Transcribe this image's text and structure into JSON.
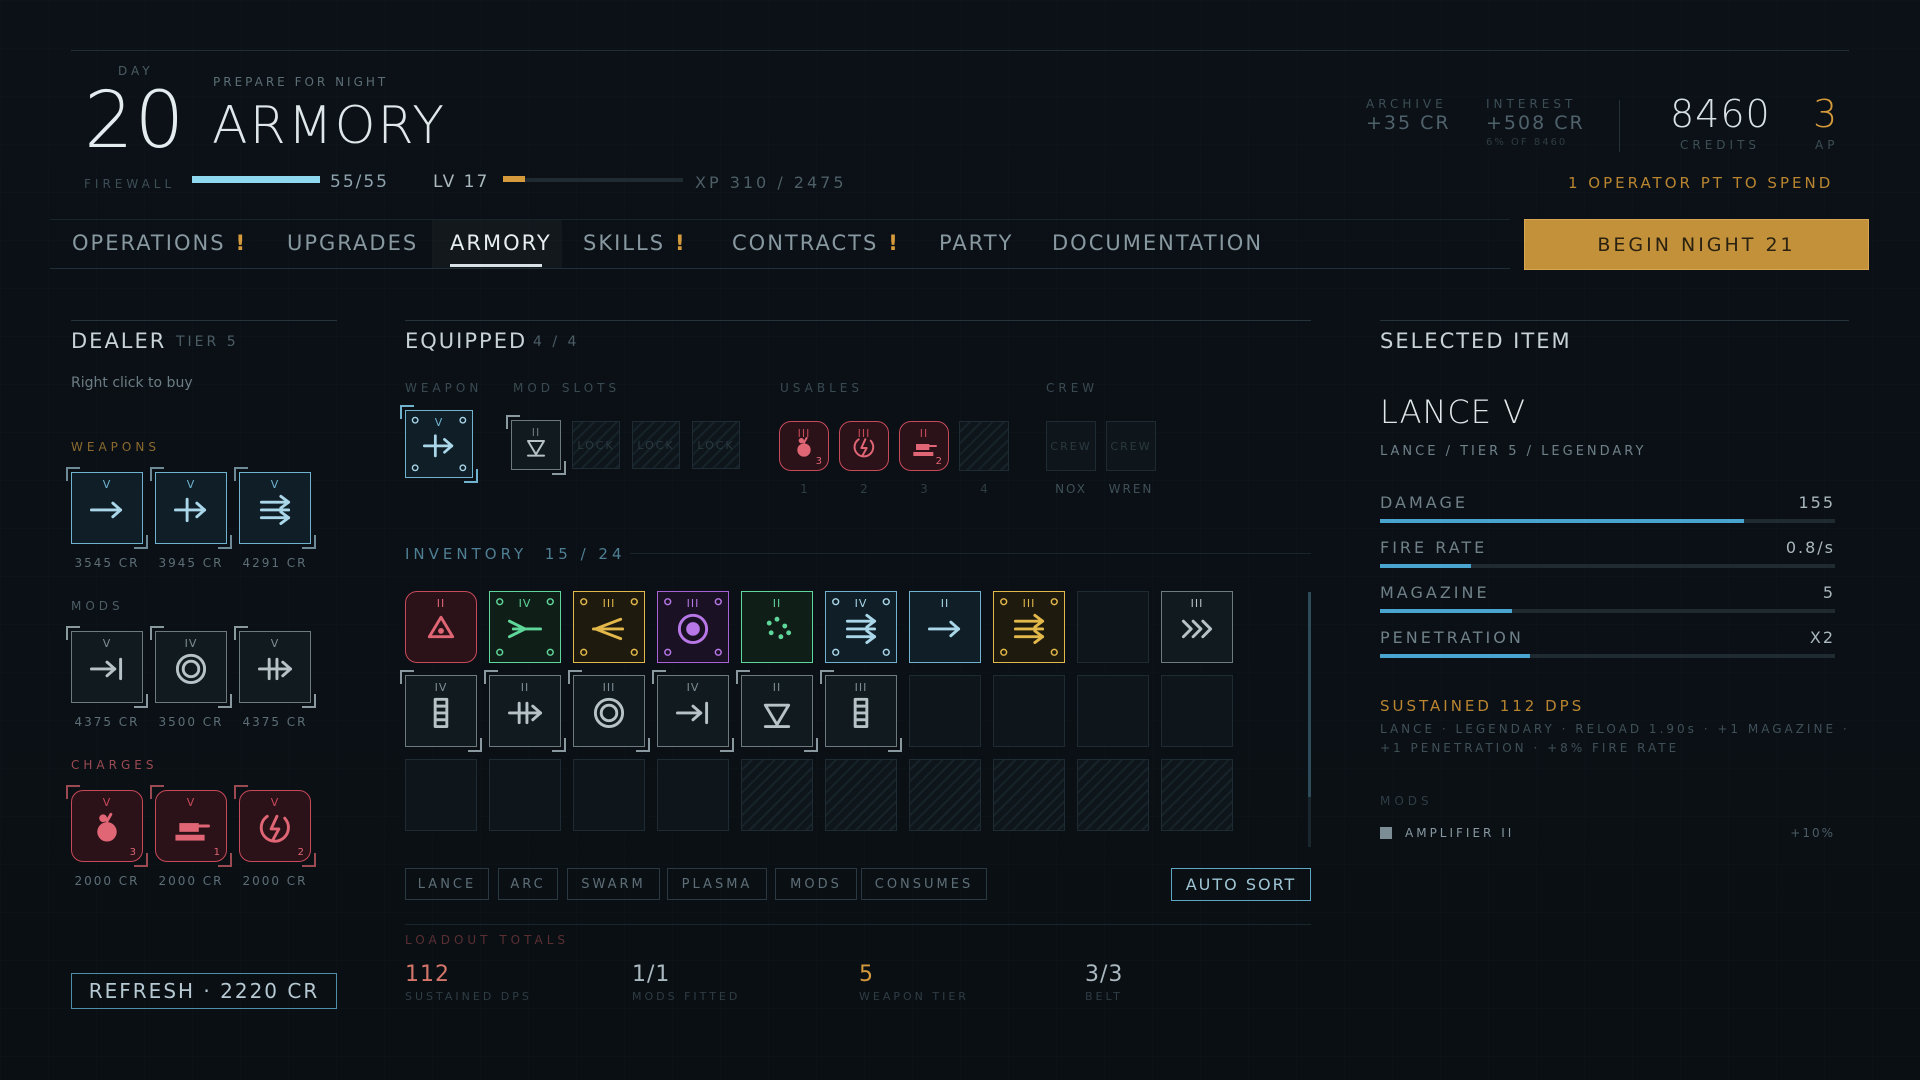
{
  "header": {
    "day_label": "DAY",
    "day": "20",
    "subtitle": "PREPARE FOR NIGHT",
    "title": "ARMORY",
    "firewall_label": "FIREWALL",
    "firewall_value": "55/55",
    "firewall_fraction": 1.0,
    "level": "LV 17",
    "xp": "XP 310 / 2475",
    "xp_fraction": 0.125,
    "archive_label": "ARCHIVE",
    "archive_value": "+35 CR",
    "interest_label": "INTEREST",
    "interest_value": "+508 CR",
    "interest_note": "6% OF 8460",
    "credits": "8460",
    "credits_label": "CREDITS",
    "ap": "3",
    "ap_label": "AP",
    "operator_note": "1 OPERATOR PT TO SPEND"
  },
  "nav": {
    "tabs": [
      {
        "label": "OPERATIONS",
        "alert": "!"
      },
      {
        "label": "UPGRADES",
        "alert": ""
      },
      {
        "label": "ARMORY",
        "alert": ""
      },
      {
        "label": "SKILLS",
        "alert": "!"
      },
      {
        "label": "CONTRACTS",
        "alert": "!"
      },
      {
        "label": "PARTY",
        "alert": ""
      },
      {
        "label": "DOCUMENTATION",
        "alert": ""
      }
    ],
    "active": "ARMORY",
    "begin_button": "BEGIN NIGHT 21"
  },
  "dealer": {
    "title": "DEALER",
    "tier": "TIER 5",
    "hint": "Right click to buy",
    "weapons_label": "WEAPONS",
    "weapons": [
      {
        "tier": "V",
        "icon": "arrow-icon",
        "price": "3545 CR"
      },
      {
        "tier": "V",
        "icon": "cross-arrow-icon",
        "price": "3945 CR"
      },
      {
        "tier": "V",
        "icon": "triple-arrow-icon",
        "price": "4291 CR"
      }
    ],
    "mods_label": "MODS",
    "mods": [
      {
        "tier": "V",
        "icon": "arrow-bar-icon",
        "price": "4375 CR"
      },
      {
        "tier": "IV",
        "icon": "ring-icon",
        "price": "3500 CR"
      },
      {
        "tier": "V",
        "icon": "split-arrow-icon",
        "price": "4375 CR"
      }
    ],
    "charges_label": "CHARGES",
    "charges": [
      {
        "tier": "V",
        "icon": "bomb-icon",
        "count": "3",
        "price": "2000 CR"
      },
      {
        "tier": "V",
        "icon": "turret-icon",
        "count": "1",
        "price": "2000 CR"
      },
      {
        "tier": "V",
        "icon": "shock-icon",
        "count": "2",
        "price": "2000 CR"
      }
    ],
    "refresh_button": "REFRESH · 2220 CR"
  },
  "equipped": {
    "title": "EQUIPPED",
    "count": "4 / 4",
    "weapon_label": "WEAPON",
    "weapon_tier": "V",
    "mod_slots_label": "MOD SLOTS",
    "mod_tier": "II",
    "locked_label": "LOCK",
    "usables_label": "USABLES",
    "usables": [
      {
        "tier": "III",
        "icon": "bomb-icon",
        "count": "3",
        "key": "1"
      },
      {
        "tier": "III",
        "icon": "shock-icon",
        "count": "",
        "key": "2"
      },
      {
        "tier": "II",
        "icon": "turret-icon",
        "count": "2",
        "key": "3"
      },
      {
        "tier": "",
        "icon": "",
        "count": "",
        "key": "4"
      }
    ],
    "crew_label": "CREW",
    "crew": [
      {
        "slot": "CREW",
        "name": "NOX"
      },
      {
        "slot": "CREW",
        "name": "WREN"
      }
    ]
  },
  "inventory": {
    "title": "INVENTORY",
    "count": "15 / 24",
    "row1_tiers": [
      "II",
      "IV",
      "III",
      "III",
      "II",
      "IV",
      "II",
      "III",
      "",
      "III"
    ],
    "row2_tiers": [
      "IV",
      "II",
      "III",
      "IV",
      "II",
      "III"
    ],
    "filters": [
      "LANCE",
      "ARC",
      "SWARM",
      "PLASMA",
      "MODS",
      "CONSUMES"
    ],
    "auto_sort": "AUTO SORT"
  },
  "totals": {
    "title": "LOADOUT TOTALS",
    "items": [
      {
        "value": "112",
        "label": "SUSTAINED DPS",
        "color": "#d4756a"
      },
      {
        "value": "1/1",
        "label": "MODS FITTED",
        "color": "#aab8bf"
      },
      {
        "value": "5",
        "label": "WEAPON TIER",
        "color": "#d59a3b"
      },
      {
        "value": "3/3",
        "label": "BELT",
        "color": "#aab8bf"
      }
    ]
  },
  "selected": {
    "title": "SELECTED ITEM",
    "name": "LANCE V",
    "meta": "LANCE / TIER 5 / LEGENDARY",
    "stats": [
      {
        "label": "DAMAGE",
        "value": "155",
        "fraction": 0.8
      },
      {
        "label": "FIRE RATE",
        "value": "0.8/s",
        "fraction": 0.2
      },
      {
        "label": "MAGAZINE",
        "value": "5",
        "fraction": 0.29
      },
      {
        "label": "PENETRATION",
        "value": "X2",
        "fraction": 0.33
      }
    ],
    "sustained": "SUSTAINED 112 DPS",
    "detail1": "LANCE · LEGENDARY · RELOAD 1.90s · +1 MAGAZINE ·",
    "detail2": "+1 PENETRATION · +8% FIRE RATE",
    "mods_label": "MODS",
    "mods": [
      {
        "name": "AMPLIFIER II",
        "value": "+10%"
      }
    ]
  },
  "colors": {
    "accent": "#d59a3b",
    "blue": "#6fb3cf",
    "red": "#c84a5a",
    "green": "#5fd69a",
    "yellow": "#e2b84a",
    "purple": "#a862d8"
  }
}
